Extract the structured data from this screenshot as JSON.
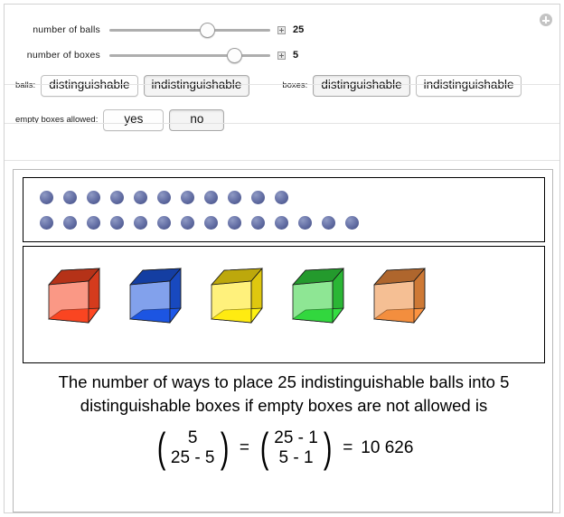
{
  "window": {
    "add_control_icon": "plus-circle-icon"
  },
  "controls": {
    "sliders": [
      {
        "label": "number of balls",
        "value": "25",
        "min": 1,
        "max": 40,
        "fraction": 0.62,
        "stepper_icon": "plus-box-icon"
      },
      {
        "label": "number of boxes",
        "value": "5",
        "min": 1,
        "max": 12,
        "fraction": 0.81,
        "stepper_icon": "plus-box-icon"
      }
    ],
    "setters": [
      {
        "label": "balls:",
        "options": [
          "distinguishable",
          "indistinguishable"
        ],
        "selected": "indistinguishable"
      },
      {
        "label": "boxes:",
        "options": [
          "distinguishable",
          "indistinguishable"
        ],
        "selected": "distinguishable"
      }
    ],
    "empty_boxes": {
      "label": "empty boxes allowed:",
      "options": [
        "yes",
        "no"
      ],
      "selected": "no"
    }
  },
  "output": {
    "balls": {
      "total": 25,
      "row1_count": 11,
      "row2_count": 14,
      "color": "#5b6699"
    },
    "boxes": {
      "count": 5,
      "colors": [
        "#e8401f",
        "#1a4fd0",
        "#f2d810",
        "#2ec63a",
        "#e0833a"
      ]
    },
    "result_line1": "The number of ways to place 25 indistinguishable balls into 5",
    "result_line2": "distinguishable boxes if empty boxes are not allowed is",
    "formula": {
      "left_top": "5",
      "left_bottom": "25 - 5",
      "equals1": "=",
      "right_top": "25 - 1",
      "right_bottom": "5 - 1",
      "equals2": "=",
      "answer": "10 626"
    }
  }
}
